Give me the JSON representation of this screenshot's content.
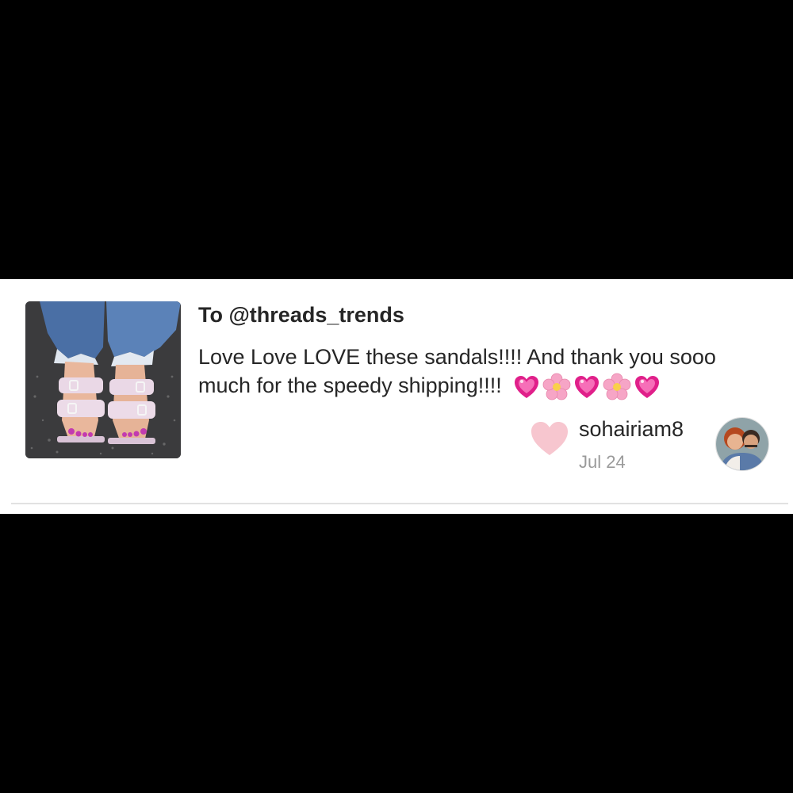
{
  "review": {
    "to_label": "To @threads_trends",
    "message": "Love Love LOVE these sandals!!!! And thank you sooo much for the speedy shipping!!!!",
    "emojis": [
      "sparkling-heart",
      "cherry-blossom",
      "sparkling-heart",
      "cherry-blossom",
      "sparkling-heart"
    ],
    "username": "sohairiam8",
    "date": "Jul 24",
    "like_color": "#f7c6cf"
  },
  "colors": {
    "background": "#000000",
    "card": "#ffffff",
    "text": "#262626",
    "muted": "#9a9a9a",
    "heart_emoji": "#e0208a",
    "blossom": "#f6a5c6"
  }
}
